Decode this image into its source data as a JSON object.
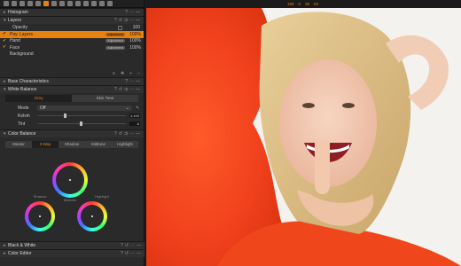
{
  "panel": {
    "histogram": "Histogram",
    "layers": {
      "title": "Layers",
      "opacity_label": "Opacity",
      "opacity_value": "100",
      "items": [
        {
          "name": "Pay. Layers",
          "checked": true,
          "selected": true,
          "badge": "Adjustment",
          "pct": "100%"
        },
        {
          "name": "Hand",
          "checked": true,
          "selected": false,
          "badge": "Adjustment",
          "pct": "100%"
        },
        {
          "name": "Face",
          "checked": true,
          "selected": false,
          "badge": "Adjustment",
          "pct": "100%"
        },
        {
          "name": "Background",
          "checked": false,
          "selected": false,
          "badge": "",
          "pct": ""
        }
      ]
    },
    "base_characteristics": "Base Characteristics",
    "white_balance": {
      "title": "White Balance",
      "tabs": [
        "Grey",
        "Skin Tone"
      ],
      "mode_label": "Mode",
      "mode_value": "Off",
      "kelvin_label": "Kelvin",
      "kelvin_value": "4,449",
      "tint_label": "Tint",
      "tint_value": "-6",
      "kelvin_level": 0.3,
      "tint_level": 0.48
    },
    "color_balance": {
      "title": "Color Balance",
      "tabs": [
        "Master",
        "3-Way",
        "Shadow",
        "Midtone",
        "Highlight"
      ],
      "wheel_labels": [
        "Shadow",
        "Midtone",
        "Highlight"
      ]
    },
    "black_white": "Black & White",
    "color_editor": "Color Editor"
  },
  "topbar": {
    "values": [
      "159",
      "0",
      "38",
      "63"
    ]
  },
  "colors": {
    "accent": "#e8820e",
    "panel_bg": "#2a2a2b"
  }
}
